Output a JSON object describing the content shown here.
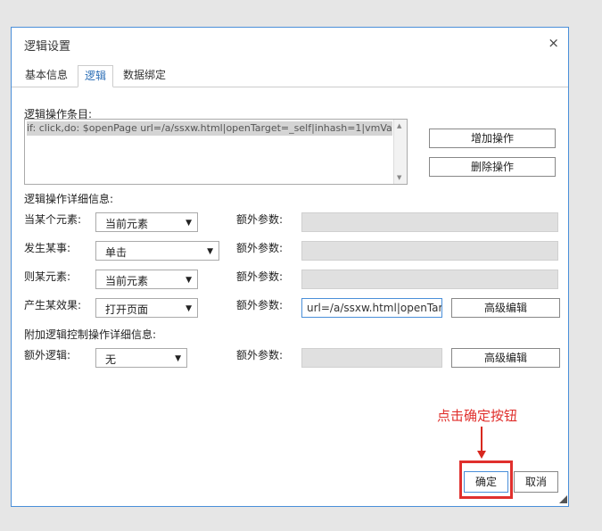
{
  "dialog": {
    "title": "逻辑设置",
    "close_glyph": "×",
    "tabs": [
      {
        "label": "基本信息",
        "active": false
      },
      {
        "label": "逻辑",
        "active": true
      },
      {
        "label": "数据绑定",
        "active": false
      }
    ]
  },
  "items_section": {
    "label": "逻辑操作条目:",
    "entries": [
      "if: click,do: $openPage url=/a/ssxw.html|openTarget=_self|inhash=1|vmVar="
    ],
    "add_button": "增加操作",
    "delete_button": "删除操作"
  },
  "details": {
    "label": "逻辑操作详细信息:",
    "rows": [
      {
        "label": "当某个元素:",
        "select": "当前元素",
        "param_label": "额外参数:",
        "param_value": ""
      },
      {
        "label": "发生某事:",
        "select": "单击",
        "param_label": "额外参数:",
        "param_value": ""
      },
      {
        "label": "则某元素:",
        "select": "当前元素",
        "param_label": "额外参数:",
        "param_value": ""
      },
      {
        "label": "产生某效果:",
        "select": "打开页面",
        "param_label": "额外参数:",
        "param_value": "url=/a/ssxw.html|openTarget=_self",
        "advanced": "高级编辑"
      }
    ]
  },
  "extra": {
    "label": "附加逻辑控制操作详细信息:",
    "row": {
      "label": "额外逻辑:",
      "select": "无",
      "param_label": "额外参数:",
      "advanced": "高级编辑"
    }
  },
  "footer": {
    "ok_button": "确定",
    "cancel_button": "取消"
  },
  "annotation": {
    "text": "点击确定按钮",
    "color": "#e0302d"
  },
  "colors": {
    "border_accent": "#4a8fd9",
    "tab_active": "#2a6db5",
    "annotation_red": "#e0302d"
  }
}
